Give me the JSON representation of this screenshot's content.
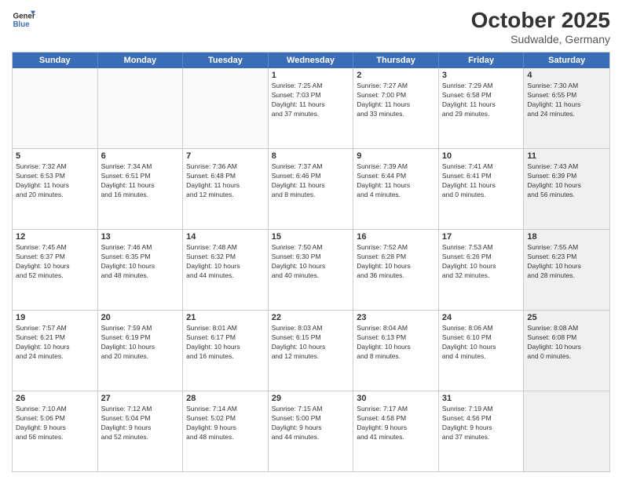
{
  "header": {
    "logo_line1": "General",
    "logo_line2": "Blue",
    "month": "October 2025",
    "location": "Sudwalde, Germany"
  },
  "days_of_week": [
    "Sunday",
    "Monday",
    "Tuesday",
    "Wednesday",
    "Thursday",
    "Friday",
    "Saturday"
  ],
  "rows": [
    [
      {
        "date": "",
        "info": "",
        "empty": true
      },
      {
        "date": "",
        "info": "",
        "empty": true
      },
      {
        "date": "",
        "info": "",
        "empty": true
      },
      {
        "date": "1",
        "info": "Sunrise: 7:25 AM\nSunset: 7:03 PM\nDaylight: 11 hours\nand 37 minutes.",
        "empty": false
      },
      {
        "date": "2",
        "info": "Sunrise: 7:27 AM\nSunset: 7:00 PM\nDaylight: 11 hours\nand 33 minutes.",
        "empty": false
      },
      {
        "date": "3",
        "info": "Sunrise: 7:29 AM\nSunset: 6:58 PM\nDaylight: 11 hours\nand 29 minutes.",
        "empty": false
      },
      {
        "date": "4",
        "info": "Sunrise: 7:30 AM\nSunset: 6:55 PM\nDaylight: 11 hours\nand 24 minutes.",
        "empty": false,
        "shaded": true
      }
    ],
    [
      {
        "date": "5",
        "info": "Sunrise: 7:32 AM\nSunset: 6:53 PM\nDaylight: 11 hours\nand 20 minutes.",
        "empty": false
      },
      {
        "date": "6",
        "info": "Sunrise: 7:34 AM\nSunset: 6:51 PM\nDaylight: 11 hours\nand 16 minutes.",
        "empty": false
      },
      {
        "date": "7",
        "info": "Sunrise: 7:36 AM\nSunset: 6:48 PM\nDaylight: 11 hours\nand 12 minutes.",
        "empty": false
      },
      {
        "date": "8",
        "info": "Sunrise: 7:37 AM\nSunset: 6:46 PM\nDaylight: 11 hours\nand 8 minutes.",
        "empty": false
      },
      {
        "date": "9",
        "info": "Sunrise: 7:39 AM\nSunset: 6:44 PM\nDaylight: 11 hours\nand 4 minutes.",
        "empty": false
      },
      {
        "date": "10",
        "info": "Sunrise: 7:41 AM\nSunset: 6:41 PM\nDaylight: 11 hours\nand 0 minutes.",
        "empty": false
      },
      {
        "date": "11",
        "info": "Sunrise: 7:43 AM\nSunset: 6:39 PM\nDaylight: 10 hours\nand 56 minutes.",
        "empty": false,
        "shaded": true
      }
    ],
    [
      {
        "date": "12",
        "info": "Sunrise: 7:45 AM\nSunset: 6:37 PM\nDaylight: 10 hours\nand 52 minutes.",
        "empty": false
      },
      {
        "date": "13",
        "info": "Sunrise: 7:46 AM\nSunset: 6:35 PM\nDaylight: 10 hours\nand 48 minutes.",
        "empty": false
      },
      {
        "date": "14",
        "info": "Sunrise: 7:48 AM\nSunset: 6:32 PM\nDaylight: 10 hours\nand 44 minutes.",
        "empty": false
      },
      {
        "date": "15",
        "info": "Sunrise: 7:50 AM\nSunset: 6:30 PM\nDaylight: 10 hours\nand 40 minutes.",
        "empty": false
      },
      {
        "date": "16",
        "info": "Sunrise: 7:52 AM\nSunset: 6:28 PM\nDaylight: 10 hours\nand 36 minutes.",
        "empty": false
      },
      {
        "date": "17",
        "info": "Sunrise: 7:53 AM\nSunset: 6:26 PM\nDaylight: 10 hours\nand 32 minutes.",
        "empty": false
      },
      {
        "date": "18",
        "info": "Sunrise: 7:55 AM\nSunset: 6:23 PM\nDaylight: 10 hours\nand 28 minutes.",
        "empty": false,
        "shaded": true
      }
    ],
    [
      {
        "date": "19",
        "info": "Sunrise: 7:57 AM\nSunset: 6:21 PM\nDaylight: 10 hours\nand 24 minutes.",
        "empty": false
      },
      {
        "date": "20",
        "info": "Sunrise: 7:59 AM\nSunset: 6:19 PM\nDaylight: 10 hours\nand 20 minutes.",
        "empty": false
      },
      {
        "date": "21",
        "info": "Sunrise: 8:01 AM\nSunset: 6:17 PM\nDaylight: 10 hours\nand 16 minutes.",
        "empty": false
      },
      {
        "date": "22",
        "info": "Sunrise: 8:03 AM\nSunset: 6:15 PM\nDaylight: 10 hours\nand 12 minutes.",
        "empty": false
      },
      {
        "date": "23",
        "info": "Sunrise: 8:04 AM\nSunset: 6:13 PM\nDaylight: 10 hours\nand 8 minutes.",
        "empty": false
      },
      {
        "date": "24",
        "info": "Sunrise: 8:06 AM\nSunset: 6:10 PM\nDaylight: 10 hours\nand 4 minutes.",
        "empty": false
      },
      {
        "date": "25",
        "info": "Sunrise: 8:08 AM\nSunset: 6:08 PM\nDaylight: 10 hours\nand 0 minutes.",
        "empty": false,
        "shaded": true
      }
    ],
    [
      {
        "date": "26",
        "info": "Sunrise: 7:10 AM\nSunset: 5:06 PM\nDaylight: 9 hours\nand 56 minutes.",
        "empty": false
      },
      {
        "date": "27",
        "info": "Sunrise: 7:12 AM\nSunset: 5:04 PM\nDaylight: 9 hours\nand 52 minutes.",
        "empty": false
      },
      {
        "date": "28",
        "info": "Sunrise: 7:14 AM\nSunset: 5:02 PM\nDaylight: 9 hours\nand 48 minutes.",
        "empty": false
      },
      {
        "date": "29",
        "info": "Sunrise: 7:15 AM\nSunset: 5:00 PM\nDaylight: 9 hours\nand 44 minutes.",
        "empty": false
      },
      {
        "date": "30",
        "info": "Sunrise: 7:17 AM\nSunset: 4:58 PM\nDaylight: 9 hours\nand 41 minutes.",
        "empty": false
      },
      {
        "date": "31",
        "info": "Sunrise: 7:19 AM\nSunset: 4:56 PM\nDaylight: 9 hours\nand 37 minutes.",
        "empty": false
      },
      {
        "date": "",
        "info": "",
        "empty": true,
        "shaded": true
      }
    ]
  ]
}
